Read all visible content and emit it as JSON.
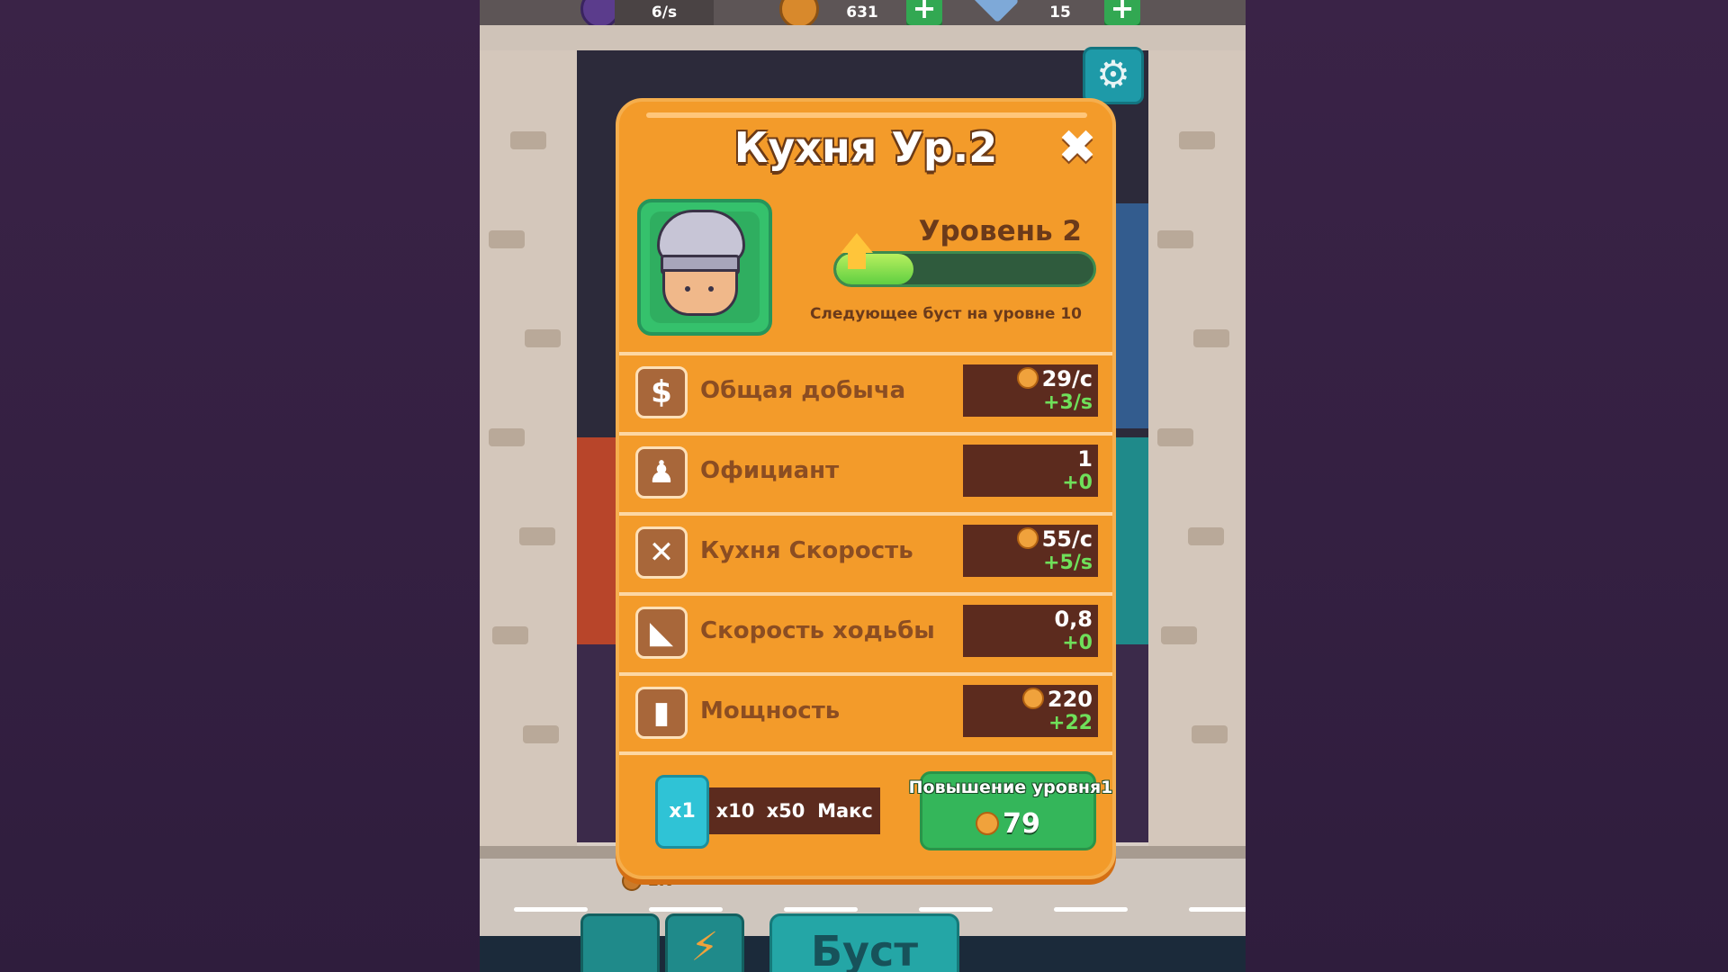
{
  "colors": {
    "modal_bg": "#f39b2a",
    "value_bg": "#5c2b1e",
    "delta_green": "#6fe05a",
    "upgrade_green": "#34b65a",
    "multiplier_active": "#2fc3d6"
  },
  "topbar": {
    "resources": [
      {
        "icon": "purple-gem-icon",
        "value": "6/s"
      },
      {
        "icon": "coin-icon",
        "value": "631"
      },
      {
        "icon": "diamond-icon",
        "value": "15"
      }
    ]
  },
  "background": {
    "cost_label": "1K",
    "boost_button": "Буст"
  },
  "modal": {
    "title": "Кухня Ур.2",
    "level_label": "Уровень 2",
    "progress": 0.3,
    "next_boost": "Следующее буст на уровне 10",
    "stats": [
      {
        "icon": "dollar-icon",
        "label": "Общая добыча",
        "value": "29/с",
        "delta": "+3/s",
        "has_coin": true
      },
      {
        "icon": "waiter-icon",
        "label": "Официант",
        "value": "1",
        "delta": "+0",
        "has_coin": false
      },
      {
        "icon": "utensils-icon",
        "label": "Кухня Скорость",
        "value": "55/с",
        "delta": "+5/s",
        "has_coin": true
      },
      {
        "icon": "shoe-icon",
        "label": "Скорость ходьбы",
        "value": "0,8",
        "delta": "+0",
        "has_coin": false
      },
      {
        "icon": "bar-chart-icon",
        "label": "Мощность",
        "value": "220",
        "delta": "+22",
        "has_coin": true
      }
    ],
    "multipliers": [
      "x1",
      "x10",
      "x50",
      "Макс"
    ],
    "upgrade_label": "Повышение уровня1",
    "upgrade_cost": "79"
  }
}
